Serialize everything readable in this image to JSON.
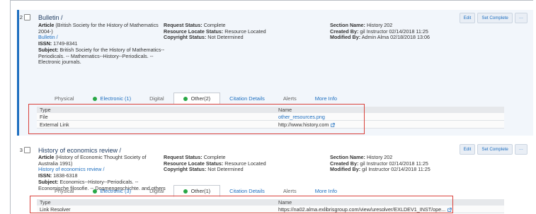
{
  "items": [
    {
      "row_number": "2",
      "title": "Bulletin /",
      "article_label": "Article",
      "article_text": "(British Society for the History of Mathematics 2004-)",
      "title_link": "Bulletin /",
      "issn_label": "ISSN:",
      "issn": "1749-8341",
      "subject_label": "Subject:",
      "subject_text": "British Society for the History of Mathematics--Periodicals. -- Mathematics--History--Periodicals. -- Electronic journals.",
      "request_status_label": "Request Status:",
      "request_status": "Complete",
      "resource_locate_label": "Resource Locate Status:",
      "resource_locate": "Resource Located",
      "copyright_label": "Copyright Status:",
      "copyright": "Not Determined",
      "section_label": "Section Name:",
      "section": "History 202",
      "created_label": "Created By:",
      "created": "gil Instructor 02/14/2018 11:25",
      "modified_label": "Modified By:",
      "modified": "Admin Alma 02/18/2018 13:06",
      "tabs": [
        "Physical",
        "Electronic (1)",
        "Digital",
        "Other(2)",
        "Citation Details",
        "Alerts",
        "More Info"
      ],
      "table_headers": [
        "Type",
        "Name"
      ],
      "table_rows": [
        {
          "type": "File",
          "name": "other_resources.png"
        },
        {
          "type": "External Link",
          "name": "http://www.history.com"
        }
      ]
    },
    {
      "row_number": "3",
      "title": "History of economics review /",
      "article_label": "Article",
      "article_text": "(History of Economic Thought Society of Australia 1991)",
      "title_link": "History of economics review /",
      "issn_label": "ISSN:",
      "issn": "1838-6318",
      "subject_label": "Subject:",
      "subject_text": "Economics--History--Periodicals. -- Economische filosofie. -- Dogmengeschichte. and others",
      "request_status_label": "Request Status:",
      "request_status": "Complete",
      "resource_locate_label": "Resource Locate Status:",
      "resource_locate": "Resource Located",
      "copyright_label": "Copyright Status:",
      "copyright": "Not Determined",
      "section_label": "Section Name:",
      "section": "History 202",
      "created_label": "Created By:",
      "created": "gil Instructor 02/14/2018 11:25",
      "modified_label": "Modified By:",
      "modified": "gil Instructor 02/14/2018 11:25",
      "tabs": [
        "Physical",
        "Electronic (3)",
        "Digital",
        "Other(1)",
        "Citation Details",
        "Alerts",
        "More Info"
      ],
      "table_headers": [
        "Type",
        "Name"
      ],
      "table_rows": [
        {
          "type": "Link Resolver",
          "name": "https://na02.alma.exlibrisgroup.com/view/uresolver/EXLDEV1_INST/ope..."
        }
      ]
    }
  ],
  "actions": {
    "edit": "Edit",
    "set_complete": "Set Complete",
    "more": "···"
  },
  "colors": {
    "accent": "#1e6fc0",
    "highlight": "#d9413b",
    "available": "#28a745"
  }
}
